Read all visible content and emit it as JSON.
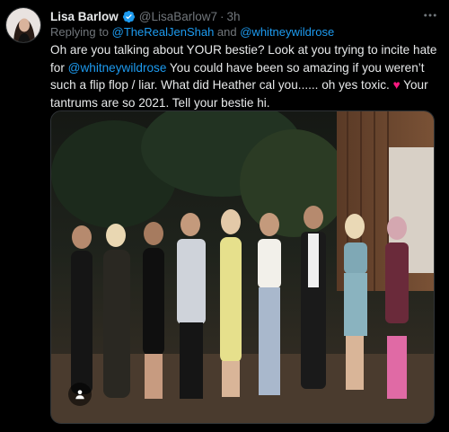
{
  "author": {
    "name": "Lisa Barlow",
    "handle": "@LisaBarlow7",
    "separator": "·",
    "time": "3h",
    "verified": true
  },
  "reply": {
    "prefix": "Replying to ",
    "mention_1": "@TheRealJenShah",
    "joiner": " and ",
    "mention_2": "@whitneywildrose"
  },
  "tweet": {
    "line_1": "Oh are you talking about YOUR bestie?  Look at you trying to incite hate for ",
    "mention": "@whitneywildrose",
    "line_2": "  You could have been so amazing if you weren’t such a flip flop / liar. What did Heather cal you...... oh yes toxic. ",
    "heart": "♥",
    "line_3": "  Your tantrums are so 2021. Tell your bestie hi."
  },
  "more_icon": "more-icon",
  "colors": {
    "background": "#000000",
    "text": "#e7e9ea",
    "muted": "#71767b",
    "link": "#1d9bf0",
    "heart": "#f91880",
    "verified": "#1d9bf0"
  }
}
